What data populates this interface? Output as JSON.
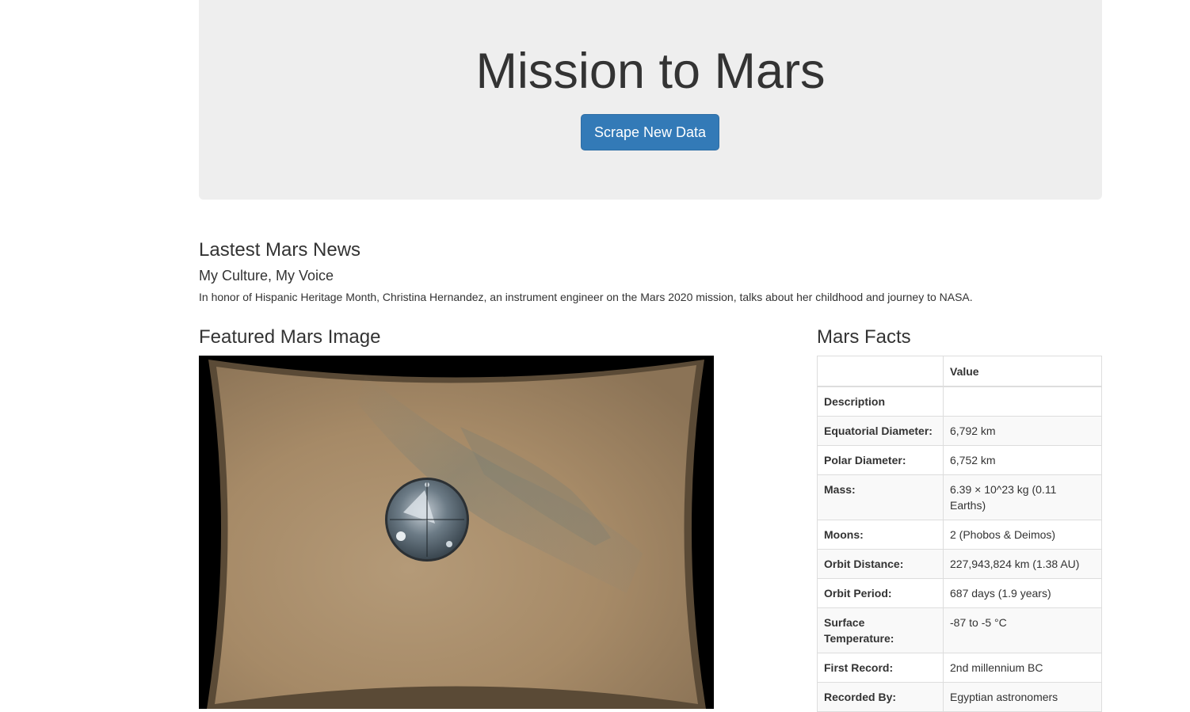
{
  "header": {
    "title": "Mission to Mars",
    "scrape_button_label": "Scrape New Data"
  },
  "news": {
    "section_heading": "Lastest Mars News",
    "title": "My Culture, My Voice",
    "paragraph": "In honor of Hispanic Heritage Month, Christina Hernandez, an instrument engineer on the Mars 2020 mission, talks about her childhood and journey to NASA."
  },
  "featured_image": {
    "section_heading": "Featured Mars Image",
    "alt": "Mars surface photo with heat shield"
  },
  "facts": {
    "section_heading": "Mars Facts",
    "column_headers": [
      "",
      "Value"
    ],
    "rows": [
      {
        "label": "Description",
        "value": ""
      },
      {
        "label": "Equatorial Diameter:",
        "value": "6,792 km"
      },
      {
        "label": "Polar Diameter:",
        "value": "6,752 km"
      },
      {
        "label": "Mass:",
        "value": "6.39 × 10^23 kg (0.11 Earths)"
      },
      {
        "label": "Moons:",
        "value": "2 (Phobos & Deimos)"
      },
      {
        "label": "Orbit Distance:",
        "value": "227,943,824 km (1.38 AU)"
      },
      {
        "label": "Orbit Period:",
        "value": "687 days (1.9 years)"
      },
      {
        "label": "Surface Temperature:",
        "value": "-87 to -5 °C"
      },
      {
        "label": "First Record:",
        "value": "2nd millennium BC"
      },
      {
        "label": "Recorded By:",
        "value": "Egyptian astronomers"
      }
    ]
  },
  "colors": {
    "jumbotron_bg": "#eeeeee",
    "button_primary": "#337ab7",
    "text": "#333333"
  }
}
